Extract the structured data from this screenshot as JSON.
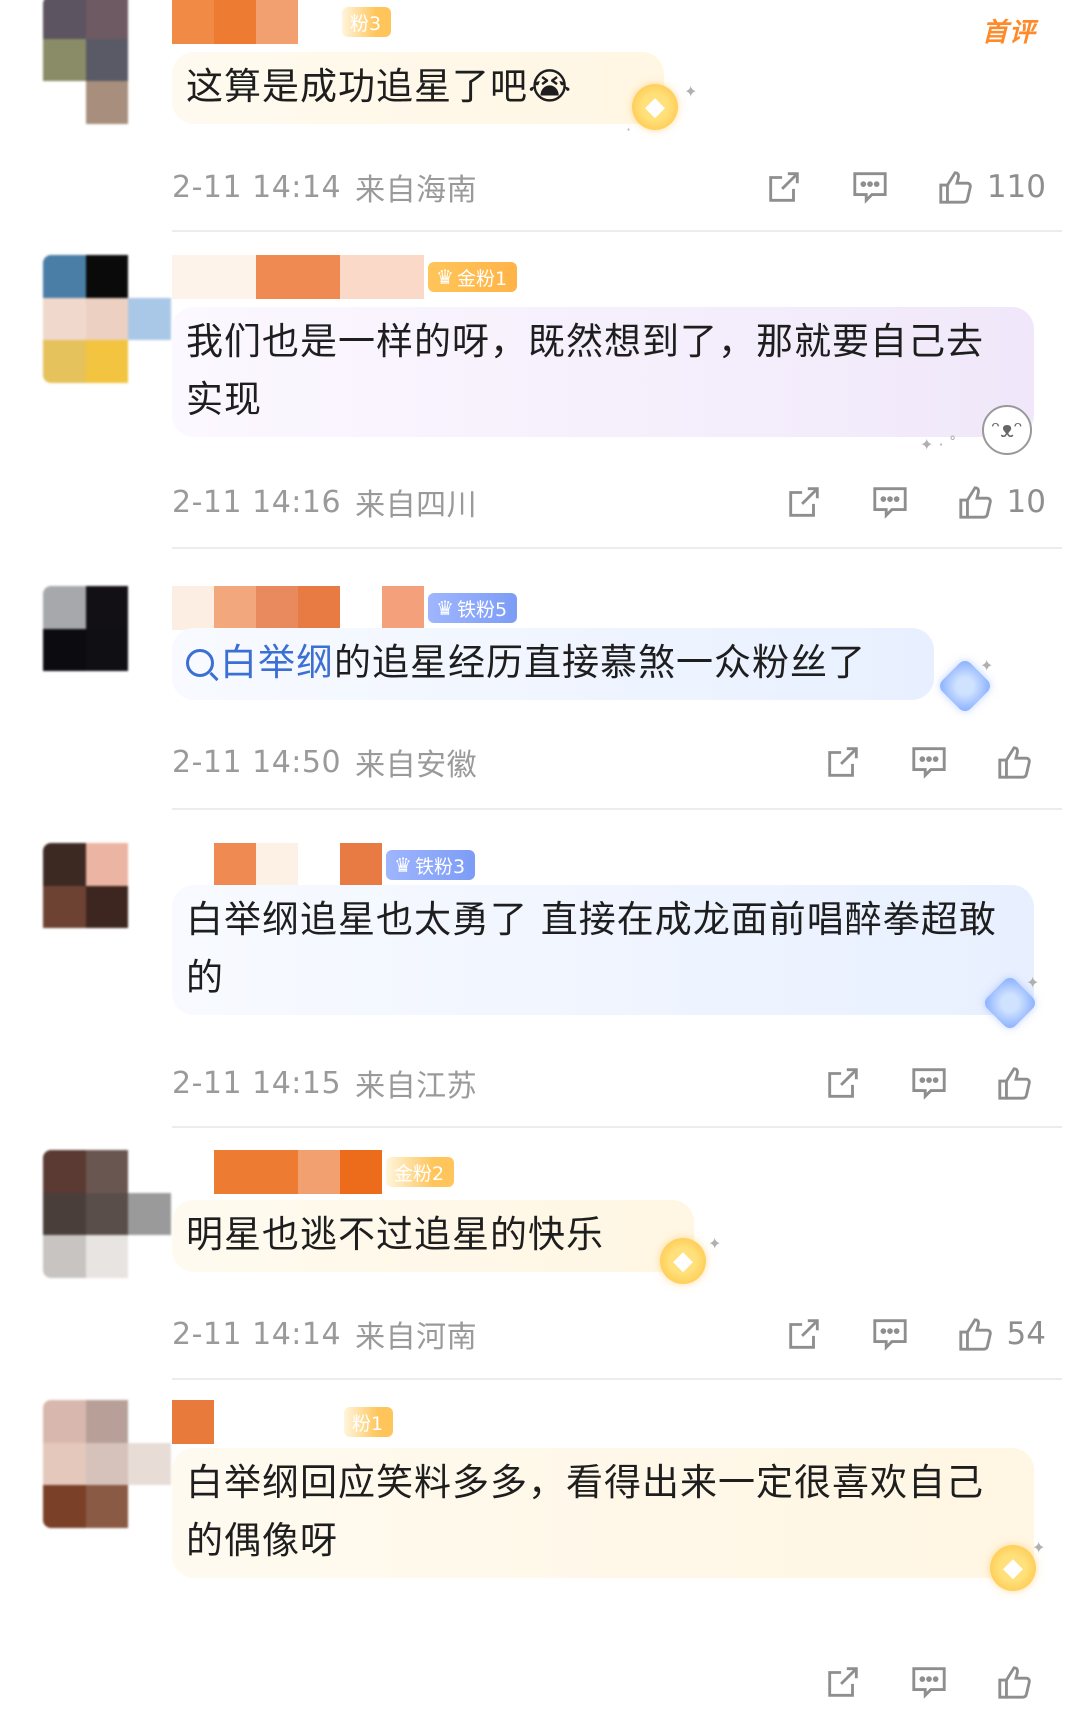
{
  "first_comment_tag": "首评",
  "comments": [
    {
      "badge": "粉3",
      "text": "这算是成功追星了吧😭",
      "time": "2-11 14:14",
      "location": "来自海南",
      "likes": "110"
    },
    {
      "badge": "金粉1",
      "text": "我们也是一样的呀，既然想到了，那就要自己去实现",
      "time": "2-11 14:16",
      "location": "来自四川",
      "likes": "10"
    },
    {
      "badge": "铁粉5",
      "link_text": "白举纲",
      "text": "的追星经历直接慕煞一众粉丝了",
      "time": "2-11 14:50",
      "location": "来自安徽",
      "likes": ""
    },
    {
      "badge": "铁粉3",
      "text": "白举纲追星也太勇了 直接在成龙面前唱醉拳超敢的",
      "time": "2-11 14:15",
      "location": "来自江苏",
      "likes": ""
    },
    {
      "badge": "金粉2",
      "text": "明星也逃不过追星的快乐",
      "time": "2-11 14:14",
      "location": "来自河南",
      "likes": "54"
    },
    {
      "badge": "粉1",
      "text": "白举纲回应笑料多多，看得出来一定很喜欢自己的偶像呀",
      "time": "",
      "location": "",
      "likes": ""
    }
  ],
  "icons": {
    "share": "share-icon",
    "comment": "comment-icon",
    "like": "thumbs-up-icon"
  },
  "colors": {
    "link": "#3b6fd4",
    "first_tag": "#ff8a2a",
    "meta_text": "#9a9a9a"
  }
}
